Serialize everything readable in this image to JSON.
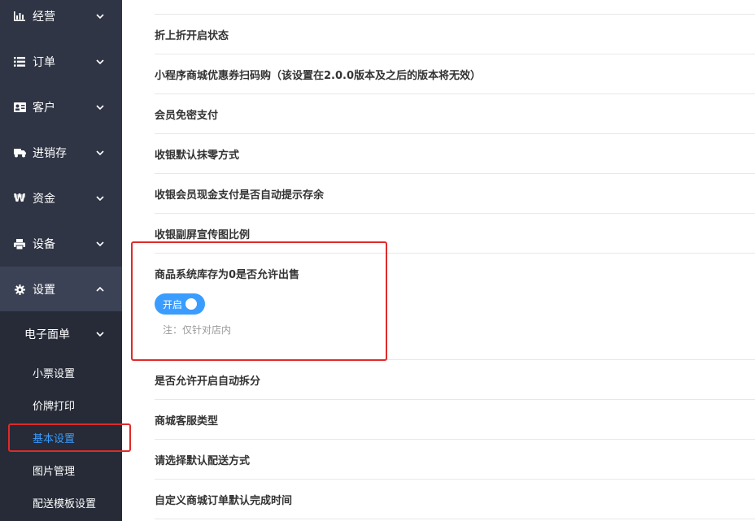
{
  "sidebar": {
    "nav": [
      {
        "label": "经营",
        "icon": "bar-chart-icon"
      },
      {
        "label": "订单",
        "icon": "list-icon"
      },
      {
        "label": "客户",
        "icon": "id-card-icon"
      },
      {
        "label": "进销存",
        "icon": "truck-icon"
      },
      {
        "label": "资金",
        "icon": "won-sign-icon"
      },
      {
        "label": "设备",
        "icon": "printer-icon"
      },
      {
        "label": "设置",
        "icon": "gear-icon"
      }
    ],
    "subgroup": {
      "label": "电子面单"
    },
    "subitems": [
      {
        "label": "小票设置"
      },
      {
        "label": "价牌打印"
      },
      {
        "label": "基本设置"
      },
      {
        "label": "图片管理"
      },
      {
        "label": "配送模板设置"
      }
    ]
  },
  "main": {
    "rows": [
      {
        "label": "折上折开启状态"
      },
      {
        "label": "小程序商城优惠券扫码购（该设置在2.0.0版本及之后的版本将无效）"
      },
      {
        "label": "会员免密支付"
      },
      {
        "label": "收银默认抹零方式"
      },
      {
        "label": "收银会员现金支付是否自动提示存余"
      },
      {
        "label": "收银副屏宣传图比例"
      },
      {
        "label": "商品系统库存为0是否允许出售"
      },
      {
        "label": "是否允许开启自动拆分"
      },
      {
        "label": "商城客服类型"
      },
      {
        "label": "请选择默认配送方式"
      },
      {
        "label": "自定义商城订单默认完成时间"
      }
    ],
    "stock_toggle": {
      "label": "开启",
      "on": true
    },
    "stock_note": "注：仅针对店内"
  },
  "colors": {
    "sidebar_bg": "#2f3544",
    "sidebar_sub_bg": "#262b37",
    "accent": "#3b9cff",
    "highlight": "#e02a2a"
  }
}
